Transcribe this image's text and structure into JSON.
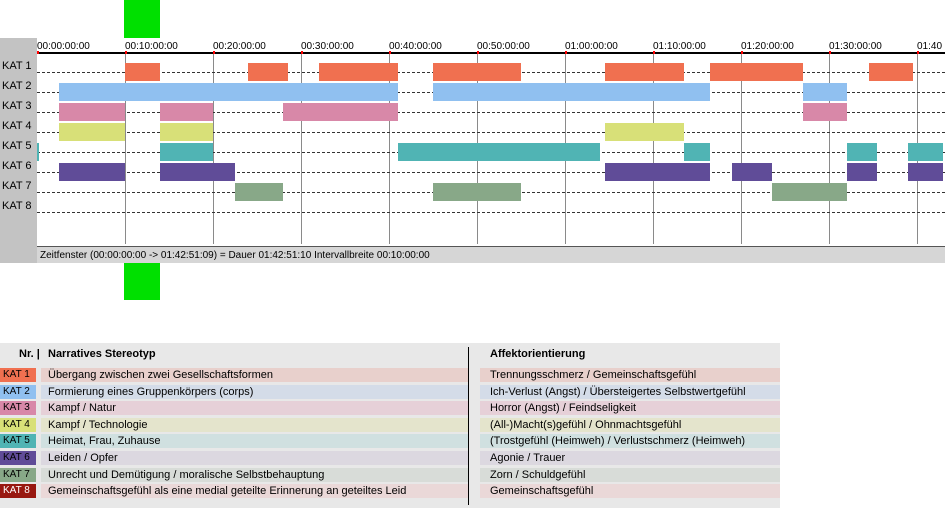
{
  "timeline": {
    "tick_labels": [
      "00:00:00:00",
      "00:10:00:00",
      "00:20:00:00",
      "00:30:00:00",
      "00:40:00:00",
      "00:50:00:00",
      "01:00:00:00",
      "01:10:00:00",
      "01:20:00:00",
      "01:30:00:00",
      "01:40"
    ],
    "row_labels": [
      "KAT 1",
      "KAT 2",
      "KAT 3",
      "KAT 4",
      "KAT 5",
      "KAT 6",
      "KAT 7",
      "KAT 8"
    ],
    "colors": [
      "#f07050",
      "#90c0f0",
      "#d888a8",
      "#d8e078",
      "#50b4b4",
      "#604c98",
      "#88a888",
      "#981810"
    ],
    "status_text": "Zeitfenster (00:00:00:00 -> 01:42:51:09) = Dauer 01:42:51:10     Intervallbreite 00:10:00:00",
    "window_start_min": 0,
    "window_end_min": 102.86,
    "interval_min": 10,
    "segments": [
      [
        [
          10,
          14
        ],
        [
          24,
          28.5
        ],
        [
          32,
          41
        ],
        [
          45,
          55
        ],
        [
          64.5,
          73.5
        ],
        [
          76.5,
          87
        ],
        [
          94.5,
          99.5
        ]
      ],
      [
        [
          2.5,
          41
        ],
        [
          45,
          76.5
        ],
        [
          87,
          92
        ]
      ],
      [
        [
          2.5,
          10
        ],
        [
          14,
          20
        ],
        [
          28,
          41
        ],
        [
          87,
          92
        ]
      ],
      [
        [
          2.5,
          10
        ],
        [
          14,
          20
        ],
        [
          64.5,
          73.5
        ]
      ],
      [
        [
          0,
          0.2
        ],
        [
          14,
          20
        ],
        [
          41,
          64
        ],
        [
          73.5,
          76.5
        ],
        [
          92,
          95.5
        ],
        [
          99,
          103
        ]
      ],
      [
        [
          2.5,
          10
        ],
        [
          14,
          22.5
        ],
        [
          64.5,
          76.5
        ],
        [
          79,
          83.5
        ],
        [
          92,
          95.5
        ],
        [
          99,
          103
        ]
      ],
      [
        [
          22.5,
          28
        ],
        [
          45,
          55
        ],
        [
          83.5,
          92
        ]
      ],
      []
    ]
  },
  "legend": {
    "headers": {
      "nr": "Nr. |",
      "stereotype": "Narratives Stereotyp",
      "affect": "Affektorientierung"
    },
    "stripe_colors": [
      "#e8d0cc",
      "#d4dce8",
      "#e6d0d8",
      "#e4e4cc",
      "#d0e0e0",
      "#dcd8e0",
      "#d8dcd8",
      "#ead8d8"
    ],
    "rows": [
      {
        "kat": "KAT 1",
        "stereotype": "Übergang zwischen zwei Gesellschaftsformen",
        "affect": "Trennungsschmerz / Gemeinschaftsgefühl"
      },
      {
        "kat": "KAT 2",
        "stereotype": "Formierung eines Gruppenkörpers (corps)",
        "affect": "Ich-Verlust (Angst) / Übersteigertes Selbstwertgefühl"
      },
      {
        "kat": "KAT 3",
        "stereotype": "Kampf / Natur",
        "affect": "Horror (Angst) / Feindseligkeit"
      },
      {
        "kat": "KAT 4",
        "stereotype": "Kampf / Technologie",
        "affect": "(All-)Macht(s)gefühl / Ohnmachtsgefühl"
      },
      {
        "kat": "KAT 5",
        "stereotype": "Heimat, Frau, Zuhause",
        "affect": "(Trostgefühl (Heimweh) / Verlustschmerz (Heimweh)"
      },
      {
        "kat": "KAT 6",
        "stereotype": "Leiden / Opfer",
        "affect": "Agonie / Trauer"
      },
      {
        "kat": "KAT 7",
        "stereotype": "Unrecht und Demütigung / moralische Selbstbehauptung",
        "affect": "Zorn / Schuldgefühl"
      },
      {
        "kat": "KAT 8",
        "stereotype": "Gemeinschaftsgefühl als eine medial geteilte Erinnerung an geteiltes Leid",
        "affect": "Gemeinschaftsgefühl"
      }
    ]
  }
}
